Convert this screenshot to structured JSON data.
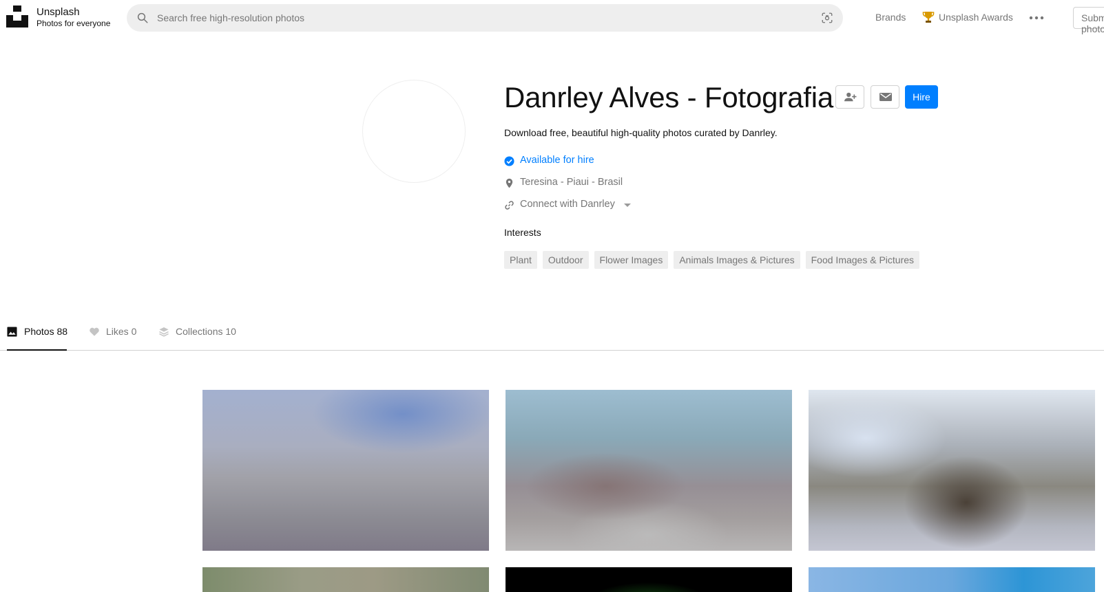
{
  "header": {
    "brand_name": "Unsplash",
    "brand_tagline": "Photos for everyone",
    "search_placeholder": "Search free high-resolution photos",
    "nav_brands": "Brands",
    "nav_awards": "Unsplash Awards",
    "submit_label": "Submit a photo"
  },
  "profile": {
    "name": "Danrley Alves - Fotografia",
    "bio": "Download free, beautiful high-quality photos curated by Danrley.",
    "availability": "Available for hire",
    "location": "Teresina - Piaui - Brasil",
    "connect": "Connect with Danrley",
    "hire_label": "Hire",
    "interests_label": "Interests",
    "interests": [
      "Plant",
      "Outdoor",
      "Flower Images",
      "Animals Images & Pictures",
      "Food Images & Pictures"
    ]
  },
  "tabs": [
    {
      "label": "Photos 88",
      "active": true
    },
    {
      "label": "Likes 0",
      "active": false
    },
    {
      "label": "Collections 10",
      "active": false
    }
  ],
  "colors": {
    "accent": "#007fff",
    "text_primary": "#111111",
    "text_muted": "#767676",
    "tag_bg": "#eeeeee",
    "trophy": "#d99a00"
  },
  "icons": {
    "logo": "unsplash-logo",
    "search": "search-icon",
    "visual_search": "visual-search-icon",
    "trophy": "trophy-icon",
    "more": "ellipsis-icon",
    "follow": "user-plus-icon",
    "message": "mail-icon",
    "available": "check-circle-icon",
    "location": "map-pin-icon",
    "link": "link-icon",
    "photos_tab": "image-icon",
    "likes_tab": "heart-icon",
    "collections_tab": "stack-icon"
  }
}
